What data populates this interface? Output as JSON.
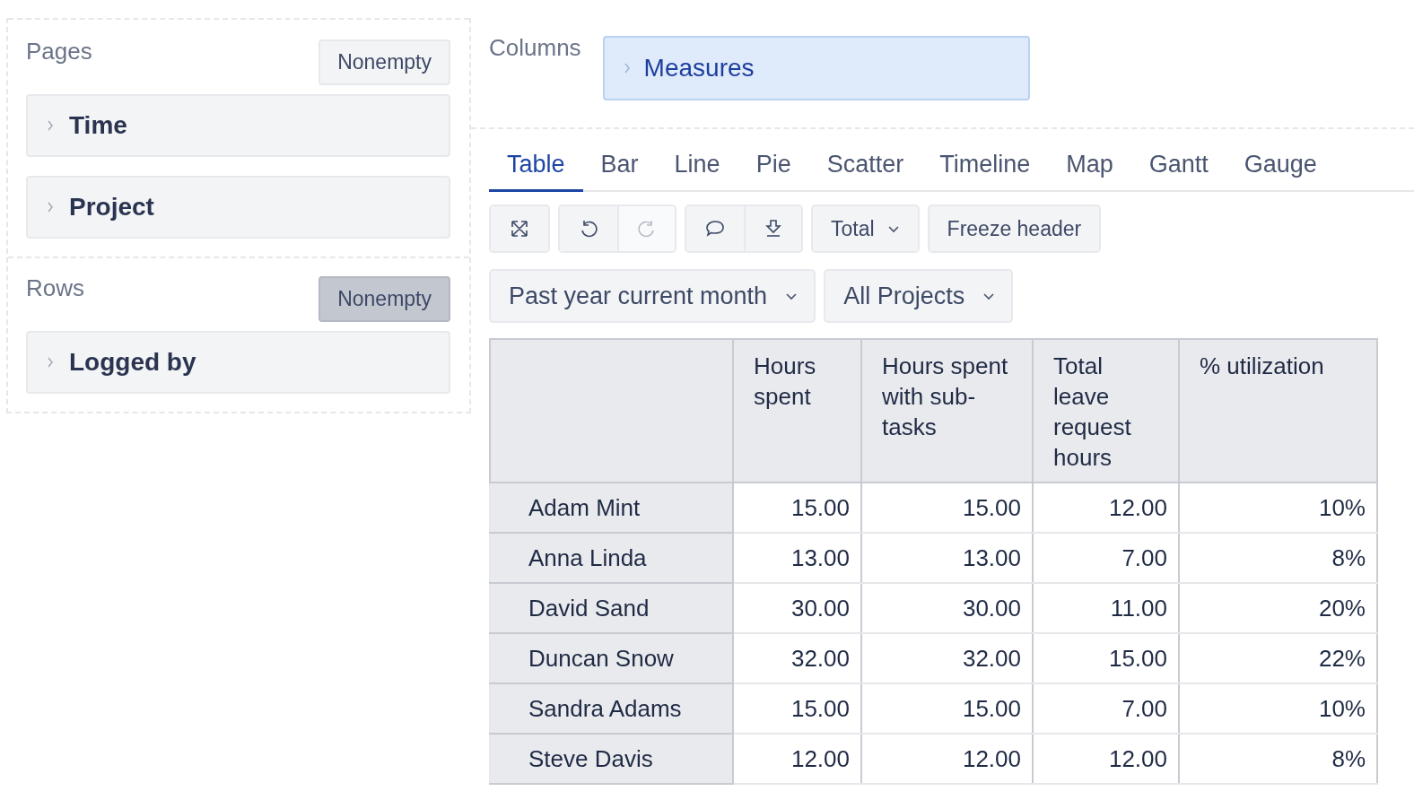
{
  "pages": {
    "title": "Pages",
    "nonempty": {
      "label": "Nonempty",
      "on": false
    },
    "items": [
      "Time",
      "Project"
    ]
  },
  "rows_panel": {
    "title": "Rows",
    "nonempty": {
      "label": "Nonempty",
      "on": true
    },
    "items": [
      "Logged by"
    ]
  },
  "columns_panel": {
    "title": "Columns",
    "items": [
      "Measures"
    ]
  },
  "tabs": [
    {
      "label": "Table",
      "selected": true
    },
    {
      "label": "Bar",
      "selected": false
    },
    {
      "label": "Line",
      "selected": false
    },
    {
      "label": "Pie",
      "selected": false
    },
    {
      "label": "Scatter",
      "selected": false
    },
    {
      "label": "Timeline",
      "selected": false
    },
    {
      "label": "Map",
      "selected": false
    },
    {
      "label": "Gantt",
      "selected": false
    },
    {
      "label": "Gauge",
      "selected": false
    }
  ],
  "toolbar": {
    "icon_groups": [
      [
        {
          "kind": "fullscreen",
          "disabled": false
        }
      ],
      [
        {
          "kind": "undo",
          "disabled": false
        },
        {
          "kind": "redo",
          "disabled": true
        }
      ],
      [
        {
          "kind": "comment",
          "disabled": false
        },
        {
          "kind": "export",
          "disabled": false
        }
      ]
    ],
    "total": "Total",
    "freeze": "Freeze header"
  },
  "filters": [
    "Past year current month",
    "All Projects"
  ],
  "table": {
    "columns": [
      "",
      "Hours spent",
      "Hours spent with sub-tasks",
      "Total leave request hours",
      "% utilization"
    ],
    "rows": [
      [
        "Adam Mint",
        "15.00",
        "15.00",
        "12.00",
        "10%"
      ],
      [
        "Anna Linda",
        "13.00",
        "13.00",
        "7.00",
        "8%"
      ],
      [
        "David Sand",
        "30.00",
        "30.00",
        "11.00",
        "20%"
      ],
      [
        "Duncan Snow",
        "32.00",
        "32.00",
        "15.00",
        "22%"
      ],
      [
        "Sandra Adams",
        "15.00",
        "15.00",
        "7.00",
        "10%"
      ],
      [
        "Steve Davis",
        "12.00",
        "12.00",
        "12.00",
        "8%"
      ]
    ]
  }
}
